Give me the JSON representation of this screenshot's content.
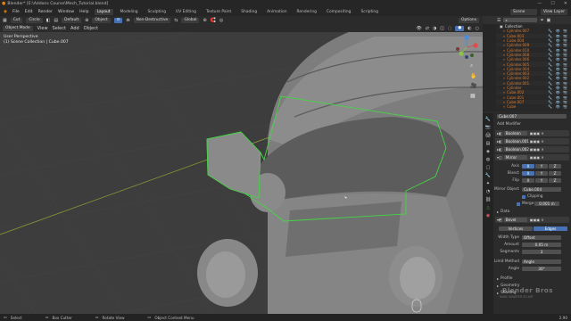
{
  "window": {
    "title": "Blender* [E:\\Addons Course\\Mech_Tutorial.blend]",
    "controls": [
      "—",
      "☐",
      "✕"
    ]
  },
  "menus": [
    "File",
    "Edit",
    "Render",
    "Window",
    "Help"
  ],
  "workspaces": [
    "Layout",
    "Modeling",
    "Sculpting",
    "UV Editing",
    "Texture Paint",
    "Shading",
    "Animation",
    "Rendering",
    "Compositing",
    "Scripting"
  ],
  "active_workspace": "Layout",
  "scene": "Scene",
  "view_layer": "View Layer",
  "header": {
    "transform_orientation": "Default",
    "drag": "Object",
    "snap_mode": "Non-Destructive",
    "orientation": "Global",
    "cut": "Cut",
    "circle": "Circle",
    "options": "Options"
  },
  "header2": {
    "mode": "Object Mode",
    "view": "View",
    "select": "Select",
    "add": "Add",
    "object": "Object"
  },
  "viewport_info": {
    "line1": "User Perspective",
    "line2": "(1) Scene Collection | Cube.007"
  },
  "outliner": {
    "collection": "Collection",
    "items": [
      "Cylinder.007",
      "Cube.003",
      "Cube.004",
      "Cylinder.009",
      "Cylinder.010",
      "Cylinder.008",
      "Cylinder.006",
      "Cylinder.005",
      "Cylinder.004",
      "Cylinder.003",
      "Cylinder.002",
      "Cylinder.001",
      "Cylinder",
      "Cube.002",
      "Cube.001",
      "Cube.007",
      "Cube"
    ]
  },
  "properties": {
    "object_name": "Cube.007",
    "add_modifier": "Add Modifier",
    "modifiers": [
      "Boolean",
      "Boolean.001",
      "Boolean.002",
      "Mirror"
    ],
    "axis_label": "Axis",
    "bisect_label": "Bisect",
    "flip_label": "Flip",
    "axes": [
      "X",
      "Y",
      "Z"
    ],
    "mirror_object_label": "Mirror Object",
    "mirror_object": "Cube.004",
    "clipping_label": "Clipping",
    "merge_label": "Merge",
    "merge_value": "0.001 m",
    "data_label": "Data",
    "bevel_name": "Bevel",
    "vertices": "Vertices",
    "edges": "Edges",
    "width_type_label": "Width Type",
    "width_type": "Offset",
    "amount_label": "Amount",
    "amount": "0.05 m",
    "segments_label": "Segments",
    "segments": "3",
    "limit_method_label": "Limit Method",
    "limit_method": "Angle",
    "angle_label": "Angle",
    "angle": "30°",
    "sections": [
      "Profile",
      "Geometry",
      "Shading"
    ]
  },
  "statusbar": [
    "Select",
    "Box Cutter",
    "Rotate View",
    "Object Context Menu"
  ],
  "version": "2.90",
  "watermark": {
    "brand": "Blender Bros",
    "tagline": "MAKE SMARTER 3D ART"
  },
  "colors": {
    "accent": "#4772b3",
    "selection": "#46d446",
    "object_orange": "#e07b2a"
  }
}
